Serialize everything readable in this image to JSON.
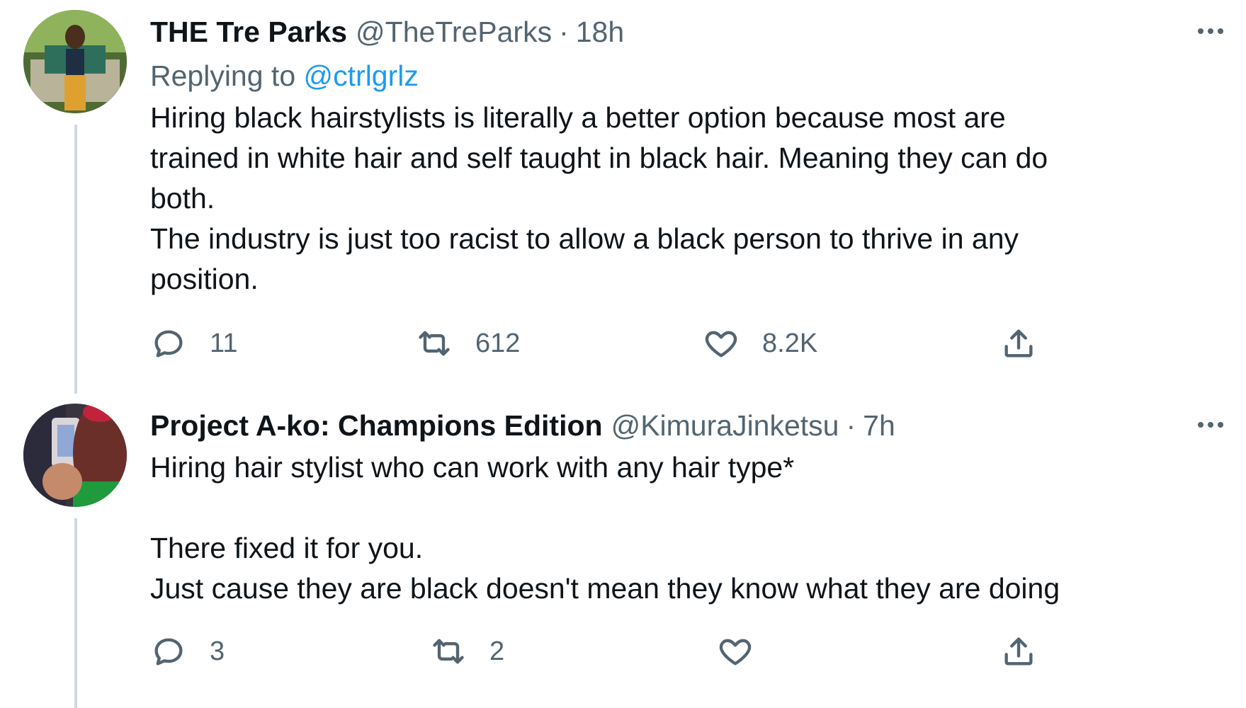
{
  "tweets": [
    {
      "name": "THE Tre Parks",
      "handle": "@TheTreParks",
      "separator": "·",
      "time": "18h",
      "replying_prefix": "Replying to",
      "replying_handle": "@ctrlgrlz",
      "text": "Hiring black hairstylists is literally a better option because most are\ntrained in white hair and self taught in black hair. Meaning they can do\nboth.\nThe industry is just too racist to allow a black person to thrive in any\nposition.",
      "replies": "11",
      "retweets": "612",
      "likes": "8.2K",
      "icons": {
        "reply": "reply-icon",
        "retweet": "retweet-icon",
        "like": "heart-icon",
        "share": "share-icon",
        "more": "more-icon"
      }
    },
    {
      "name": "Project A-ko: Champions Edition",
      "handle": "@KimuraJinketsu",
      "separator": "·",
      "time": "7h",
      "text": "Hiring hair stylist who can work with any hair type*\n\nThere fixed it for you.\nJust cause they are black doesn't mean they know what they are doing",
      "replies": "3",
      "retweets": "2",
      "likes": "",
      "icons": {
        "reply": "reply-icon",
        "retweet": "retweet-icon",
        "like": "heart-icon",
        "share": "share-icon",
        "more": "more-icon"
      }
    }
  ],
  "colors": {
    "name": "#0f1419",
    "secondary": "#536471",
    "link": "#1d9bf0",
    "thread_line": "#cfd9de"
  }
}
